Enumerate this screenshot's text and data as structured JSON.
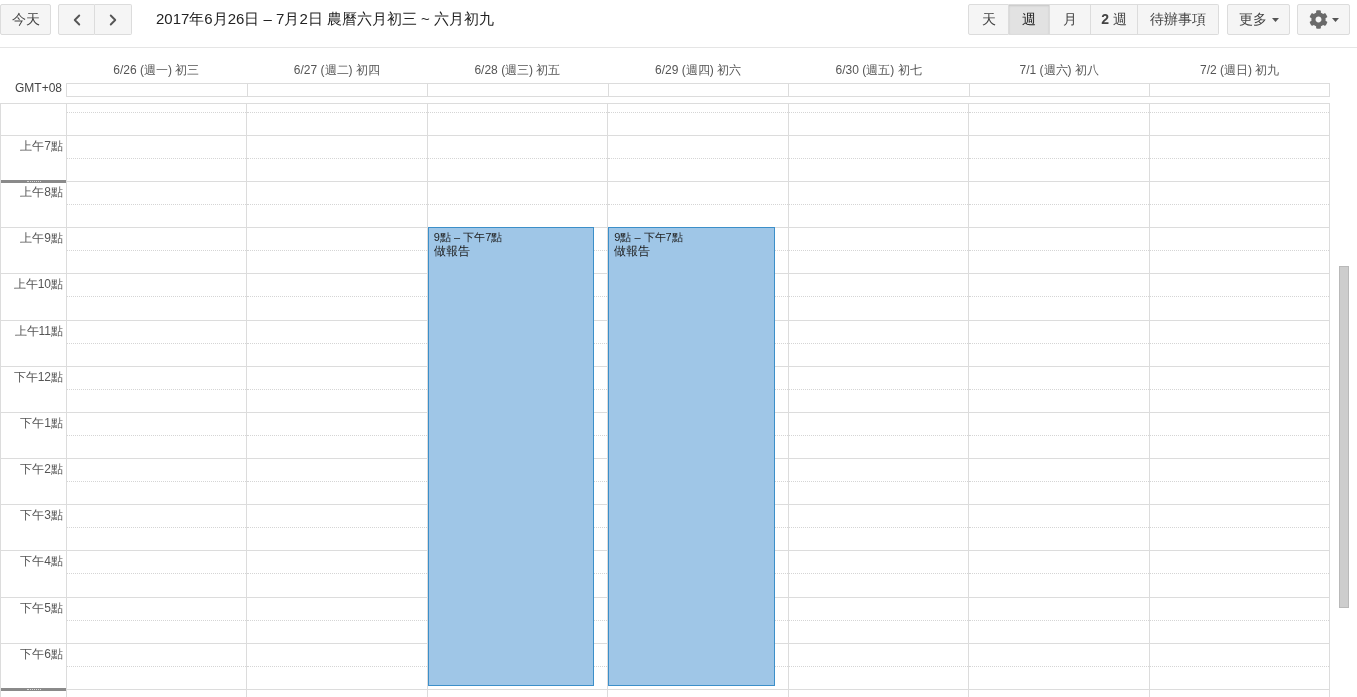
{
  "toolbar": {
    "today": "今天",
    "title": "2017年6月26日 – 7月2日 農曆六月初三 ~ 六月初九",
    "views": [
      {
        "label": "天",
        "selected": false
      },
      {
        "label": "週",
        "selected": true
      },
      {
        "label": "月",
        "selected": false
      },
      {
        "label": "**2** 週",
        "selected": false
      },
      {
        "label": "待辦事項",
        "selected": false
      }
    ],
    "more": "更多"
  },
  "timezone": "GMT+08",
  "days": [
    {
      "label": "6/26 (週一) 初三"
    },
    {
      "label": "6/27 (週二) 初四"
    },
    {
      "label": "6/28 (週三) 初五",
      "events": [
        {
          "time": "9點 – 下午7點",
          "title": "做報告"
        }
      ]
    },
    {
      "label": "6/29 (週四) 初六",
      "events": [
        {
          "time": "9點 – 下午7點",
          "title": "做報告"
        }
      ]
    },
    {
      "label": "6/30 (週五) 初七"
    },
    {
      "label": "7/1 (週六) 初八"
    },
    {
      "label": "7/2 (週日) 初九"
    }
  ],
  "hours": [
    {
      "label": "上午7點",
      "handle_above": false,
      "handle_below": false
    },
    {
      "label": "上午8點",
      "handle_above": true,
      "handle_below": false
    },
    {
      "label": "上午9點",
      "handle_above": false,
      "handle_below": false
    },
    {
      "label": "上午10點",
      "handle_above": false,
      "handle_below": false
    },
    {
      "label": "上午11點",
      "handle_above": false,
      "handle_below": false
    },
    {
      "label": "下午12點",
      "handle_above": false,
      "handle_below": false
    },
    {
      "label": "下午1點",
      "handle_above": false,
      "handle_below": false
    },
    {
      "label": "下午2點",
      "handle_above": false,
      "handle_below": false
    },
    {
      "label": "下午3點",
      "handle_above": false,
      "handle_below": false
    },
    {
      "label": "下午4點",
      "handle_above": false,
      "handle_below": false
    },
    {
      "label": "下午5點",
      "handle_above": false,
      "handle_below": false
    },
    {
      "label": "下午6點",
      "handle_above": false,
      "handle_below": true
    }
  ]
}
